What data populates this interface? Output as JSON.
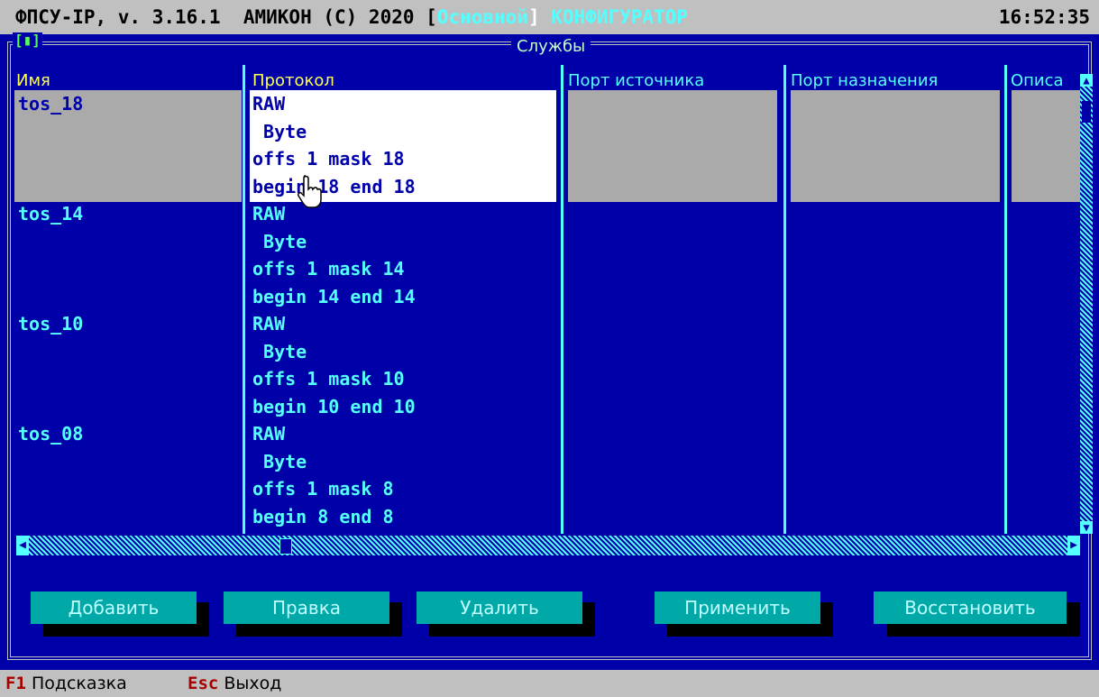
{
  "titlebar": {
    "app": "ФПСУ-IP, v. 3.16.1  АМИКОН (C) 2020 [",
    "mode": "Основной",
    "bracket_close": "] ",
    "section": "КОНФИГУРАТОР",
    "clock": "16:52:35"
  },
  "window": {
    "control": "[▮]",
    "title": "Службы"
  },
  "table": {
    "headers": {
      "name": "Имя",
      "protocol": "Протокол",
      "src_port": "Порт источника",
      "dst_port": "Порт назначения",
      "desc": "Описа"
    },
    "rows": [
      {
        "name": "tos_18",
        "protocol": [
          "RAW",
          " Byte",
          "offs 1 mask 18",
          "begin 18 end 18"
        ]
      },
      {
        "name": "tos_14",
        "protocol": [
          "RAW",
          " Byte",
          "offs 1 mask 14",
          "begin 14 end 14"
        ]
      },
      {
        "name": "tos_10",
        "protocol": [
          "RAW",
          " Byte",
          "offs 1 mask 10",
          "begin 10 end 10"
        ]
      },
      {
        "name": "tos_08",
        "protocol": [
          "RAW",
          " Byte",
          "offs 1 mask 8",
          "begin 8 end 8"
        ]
      }
    ]
  },
  "buttons": {
    "add": "Добавить",
    "edit": "Правка",
    "delete": "Удалить",
    "apply": "Применить",
    "restore": "Восстановить"
  },
  "statusbar": {
    "f1_key": "F1",
    "f1_label": "Подсказка",
    "esc_key": "Esc",
    "esc_label": "Выход"
  },
  "icons": {
    "scroll_up": "▲",
    "scroll_down": "▼",
    "scroll_left": "◀",
    "scroll_right": "▶"
  }
}
